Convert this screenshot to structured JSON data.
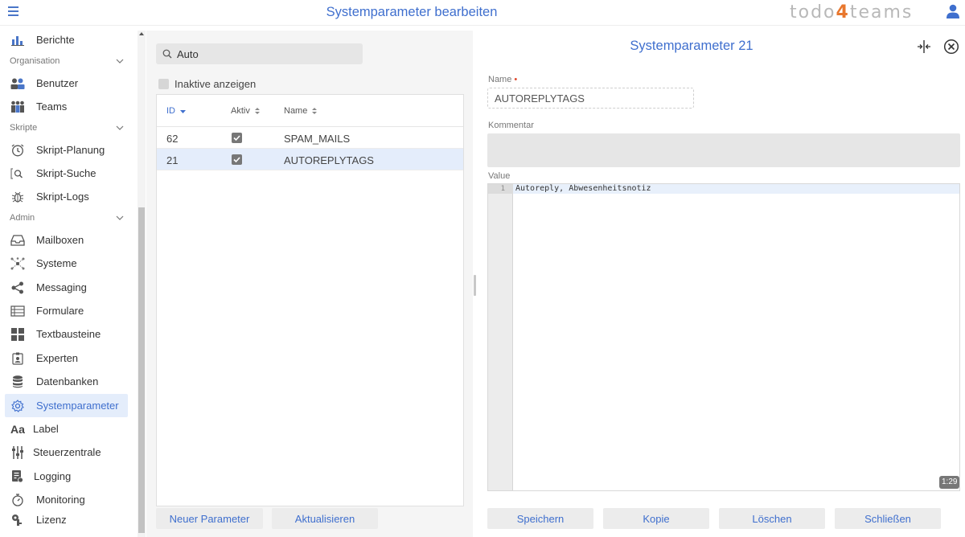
{
  "header": {
    "title": "Systemparameter bearbeiten",
    "brand_prefix": "todo",
    "brand_accent": "4",
    "brand_suffix": "teams"
  },
  "sidebar": {
    "items": [
      {
        "label": "Berichte",
        "icon": "bar-chart-icon"
      },
      {
        "section": "Organisation"
      },
      {
        "label": "Benutzer",
        "icon": "users-icon"
      },
      {
        "label": "Teams",
        "icon": "teams-icon"
      },
      {
        "section": "Skripte"
      },
      {
        "label": "Skript-Planung",
        "icon": "clock-icon"
      },
      {
        "label": "Skript-Suche",
        "icon": "search-code-icon"
      },
      {
        "label": "Skript-Logs",
        "icon": "bug-icon"
      },
      {
        "section": "Admin"
      },
      {
        "label": "Mailboxen",
        "icon": "inbox-icon"
      },
      {
        "label": "Systeme",
        "icon": "network-icon"
      },
      {
        "label": "Messaging",
        "icon": "share-icon"
      },
      {
        "label": "Formulare",
        "icon": "form-icon"
      },
      {
        "label": "Textbausteine",
        "icon": "grid-icon"
      },
      {
        "label": "Experten",
        "icon": "badge-icon"
      },
      {
        "label": "Datenbanken",
        "icon": "database-icon"
      },
      {
        "label": "Systemparameter",
        "icon": "gear-icon",
        "active": true
      },
      {
        "label": "Label",
        "icon": "text-format-icon"
      },
      {
        "label": "Steuerzentrale",
        "icon": "sliders-icon"
      },
      {
        "label": "Logging",
        "icon": "log-icon"
      },
      {
        "label": "Monitoring",
        "icon": "timer-icon"
      },
      {
        "label": "Lizenz",
        "icon": "key-icon"
      }
    ]
  },
  "list": {
    "search_value": "Auto",
    "inactive_label": "Inaktive anzeigen",
    "columns": {
      "id": "ID",
      "active": "Aktiv",
      "name": "Name"
    },
    "rows": [
      {
        "id": "62",
        "active": true,
        "name": "SPAM_MAILS",
        "selected": false
      },
      {
        "id": "21",
        "active": true,
        "name": "AUTOREPLYTAGS",
        "selected": true
      }
    ],
    "new_button": "Neuer Parameter",
    "refresh_button": "Aktualisieren"
  },
  "detail": {
    "title": "Systemparameter 21",
    "name_label": "Name",
    "name_required_mark": "•",
    "name_value": "AUTOREPLYTAGS",
    "comment_label": "Kommentar",
    "comment_value": "",
    "value_label": "Value",
    "line_number": "1",
    "code": "Autoreply, Abwesenheitsnotiz",
    "cursor_position": "1:29",
    "buttons": {
      "save": "Speichern",
      "copy": "Kopie",
      "delete": "Löschen",
      "close": "Schließen"
    }
  },
  "colors": {
    "accent": "#3f6fce",
    "brand_accent": "#e8772e",
    "selected_bg": "#e4edfb"
  }
}
